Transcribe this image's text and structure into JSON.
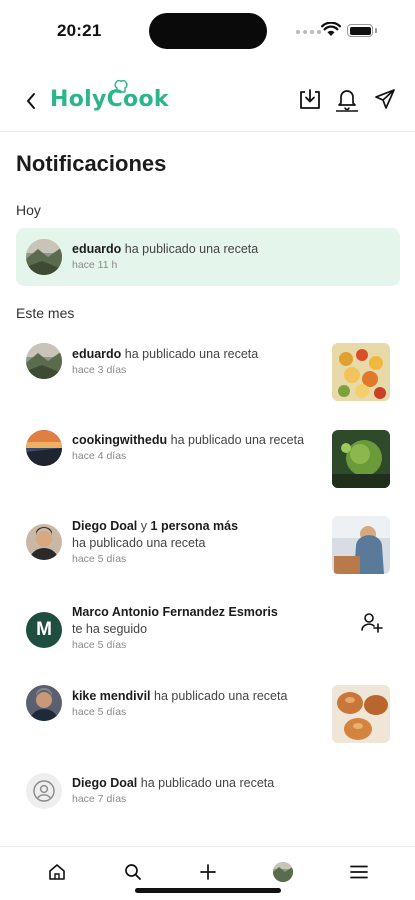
{
  "status_bar": {
    "time": "20:21"
  },
  "header": {
    "logo_text": "HolyCook"
  },
  "page": {
    "title": "Notificaciones"
  },
  "sections": {
    "today": "Hoy",
    "this_month": "Este mes"
  },
  "notifications": [
    {
      "user": "eduardo",
      "action": "ha publicado una receta",
      "time": "hace 11 h"
    },
    {
      "user": "eduardo",
      "action": "ha publicado una receta",
      "time": "hace 3 días"
    },
    {
      "user": "cookingwithedu",
      "action": "ha publicado una receta",
      "time": "hace 4 días"
    },
    {
      "user": "Diego Doal",
      "extra": "y",
      "others": "1 persona más",
      "action": "ha publicado una receta",
      "time": "hace 5 días"
    },
    {
      "user": "Marco Antonio Fernandez Esmoris",
      "action": "te ha seguido",
      "time": "hace 5 días",
      "avatar_letter": "M"
    },
    {
      "user": "kike mendivil",
      "action": "ha publicado una receta",
      "time": "hace 5 días"
    },
    {
      "user": "Diego Doal",
      "action": "ha publicado una receta",
      "time": "hace 7 días"
    }
  ],
  "colors": {
    "brand": "#2bb58b",
    "highlight_bg": "#e4f5ec",
    "avatar_letter_bg": "#1f4d3f"
  },
  "icons": {
    "header": [
      "back-chevron-icon",
      "download-icon",
      "bell-icon",
      "send-icon"
    ],
    "tabs": [
      "home-icon",
      "search-icon",
      "plus-icon",
      "profile-avatar",
      "menu-icon"
    ]
  }
}
